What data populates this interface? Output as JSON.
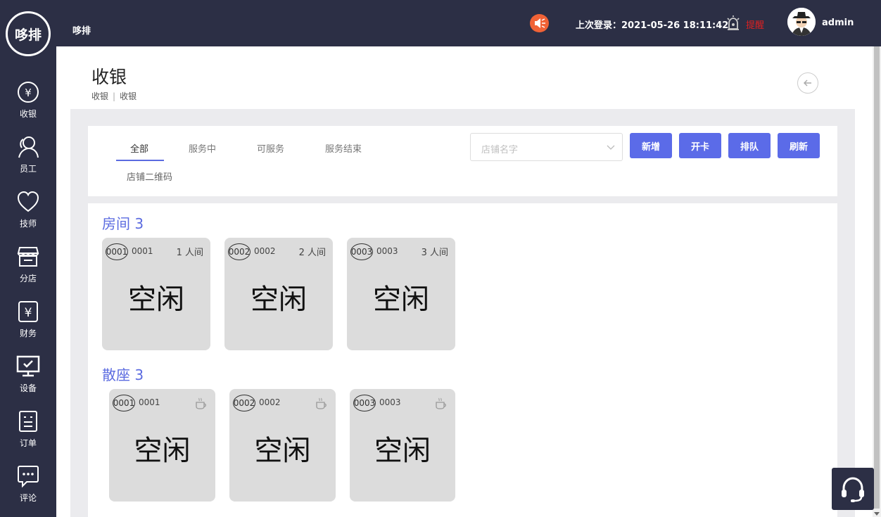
{
  "logo": {
    "text": "哆排"
  },
  "sidebar": {
    "items": [
      {
        "label": "收银",
        "icon": "yuan-circle-icon"
      },
      {
        "label": "员工",
        "icon": "staff-icon"
      },
      {
        "label": "技师",
        "icon": "heart-icon"
      },
      {
        "label": "分店",
        "icon": "store-icon"
      },
      {
        "label": "财务",
        "icon": "finance-icon"
      },
      {
        "label": "设备",
        "icon": "monitor-icon"
      },
      {
        "label": "订单",
        "icon": "order-icon"
      },
      {
        "label": "评论",
        "icon": "comment-icon"
      }
    ]
  },
  "header": {
    "app_name": "哆排",
    "last_login": "上次登录：2021-05-26 18:11:42",
    "remind": "提醒",
    "username": "admin",
    "colors": {
      "bar": "#2c2f45",
      "sound": "#f06236",
      "remind": "#e02020"
    }
  },
  "page": {
    "title": "收银",
    "breadcrumb": [
      "收银",
      "收银"
    ]
  },
  "filter": {
    "tabs": [
      "全部",
      "服务中",
      "可服务",
      "服务结束"
    ],
    "active_tab": "全部",
    "qr_link": "店铺二维码",
    "store_select_placeholder": "店铺名字",
    "buttons": [
      "新增",
      "开卡",
      "排队",
      "刷新"
    ],
    "accent": "#5b6be8"
  },
  "sections": [
    {
      "title": "房间 3",
      "tiles": [
        {
          "badge": "0001",
          "number": "0001",
          "capacity": "1 人间",
          "status": "空闲"
        },
        {
          "badge": "0002",
          "number": "0002",
          "capacity": "2 人间",
          "status": "空闲"
        },
        {
          "badge": "0003",
          "number": "0003",
          "capacity": "3 人间",
          "status": "空闲"
        }
      ]
    },
    {
      "title": "散座 3",
      "tiles": [
        {
          "badge": "0001",
          "number": "0001",
          "icon": "coffee-cup-icon",
          "status": "空闲"
        },
        {
          "badge": "0002",
          "number": "0002",
          "icon": "coffee-cup-icon",
          "status": "空闲"
        },
        {
          "badge": "0003",
          "number": "0003",
          "icon": "coffee-cup-icon",
          "status": "空闲"
        }
      ]
    }
  ]
}
